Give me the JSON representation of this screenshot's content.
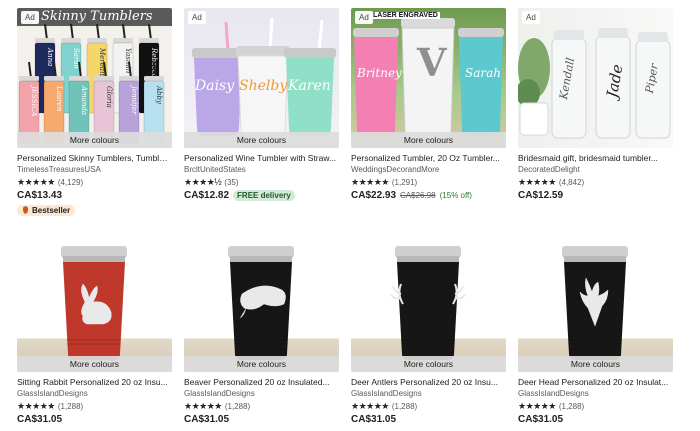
{
  "labels": {
    "ad": "Ad",
    "more_colours": "More colours",
    "free_delivery": "FREE delivery",
    "bestseller": "Bestseller"
  },
  "colors": {
    "star": "#222222",
    "free_bg": "#d4e9d7",
    "bestseller_bg": "#fde7d2"
  },
  "listings": [
    {
      "title": "Personalized Skinny Tumblers, Tumbler...",
      "shop": "TimelessTreasuresUSA",
      "stars": "★★★★★",
      "reviews": "(4,129)",
      "price": "CA$13.43",
      "bestseller": true,
      "image_text": "Skinny Tumblers",
      "tumbler_names": [
        "Anna",
        "Sarah",
        "Meredith",
        "Yasmin",
        "Rebecca",
        "JESSICA",
        "Lauren",
        "Amanda",
        "Gloria",
        "Jennifer",
        "Abby"
      ],
      "colors": [
        "#1f2a5c",
        "#7fd3cf",
        "#f4d66a",
        "#f2f2f2",
        "#111111",
        "#f2a2a8",
        "#f6a96c",
        "#6fc3b8",
        "#e9c3d6",
        "#b7a3d9",
        "#b6e0f0"
      ]
    },
    {
      "title": "Personalized Wine Tumbler with Straw...",
      "shop": "BrcltUnitedStates",
      "stars": "★★★★½",
      "reviews": "(35)",
      "price": "CA$12.82",
      "free_delivery": true,
      "image_text": [
        "Daisy",
        "Shelby",
        "Karen"
      ],
      "colors": [
        "#b9a7e8",
        "#f6f6f6",
        "#8fe0c7"
      ]
    },
    {
      "title": "Personalized Tumbler, 20 Oz Tumbler...",
      "shop": "WeddingsDecorandMore",
      "stars": "★★★★★",
      "reviews": "(1,291)",
      "price": "CA$22.93",
      "old_price": "CA$26.98",
      "discount": "(15% off)",
      "image_text": [
        "Britney",
        "V",
        "Sarah"
      ],
      "header_text": "LASER ENGRAVED",
      "colors": [
        "#f47fb2",
        "#f4f4f4",
        "#5cc9cf"
      ]
    },
    {
      "title": "Bridesmaid gift, bridesmaid tumbler...",
      "shop": "DecoratedDelight",
      "stars": "★★★★★",
      "reviews": "(4,842)",
      "price": "CA$12.59",
      "image_text": [
        "Kendall",
        "Jade",
        "Piper"
      ]
    },
    {
      "title": "Sitting Rabbit Personalized 20 oz Insu...",
      "shop": "GlassIslandDesigns",
      "stars": "★★★★★",
      "reviews": "(1,288)",
      "price": "CA$31.05",
      "tumbler_color": "#c0382b",
      "engraving": "rabbit"
    },
    {
      "title": "Beaver Personalized 20 oz Insulated...",
      "shop": "GlassIslandDesigns",
      "stars": "★★★★★",
      "reviews": "(1,288)",
      "price": "CA$31.05",
      "tumbler_color": "#161616",
      "engraving": "beaver"
    },
    {
      "title": "Deer Antlers Personalized 20 oz Insu...",
      "shop": "GlassIslandDesigns",
      "stars": "★★★★★",
      "reviews": "(1,288)",
      "price": "CA$31.05",
      "tumbler_color": "#161616",
      "engraving": "antlers"
    },
    {
      "title": "Deer Head Personalized 20 oz Insulat...",
      "shop": "GlassIslandDesigns",
      "stars": "★★★★★",
      "reviews": "(1,288)",
      "price": "CA$31.05",
      "tumbler_color": "#161616",
      "engraving": "deer-head"
    }
  ]
}
